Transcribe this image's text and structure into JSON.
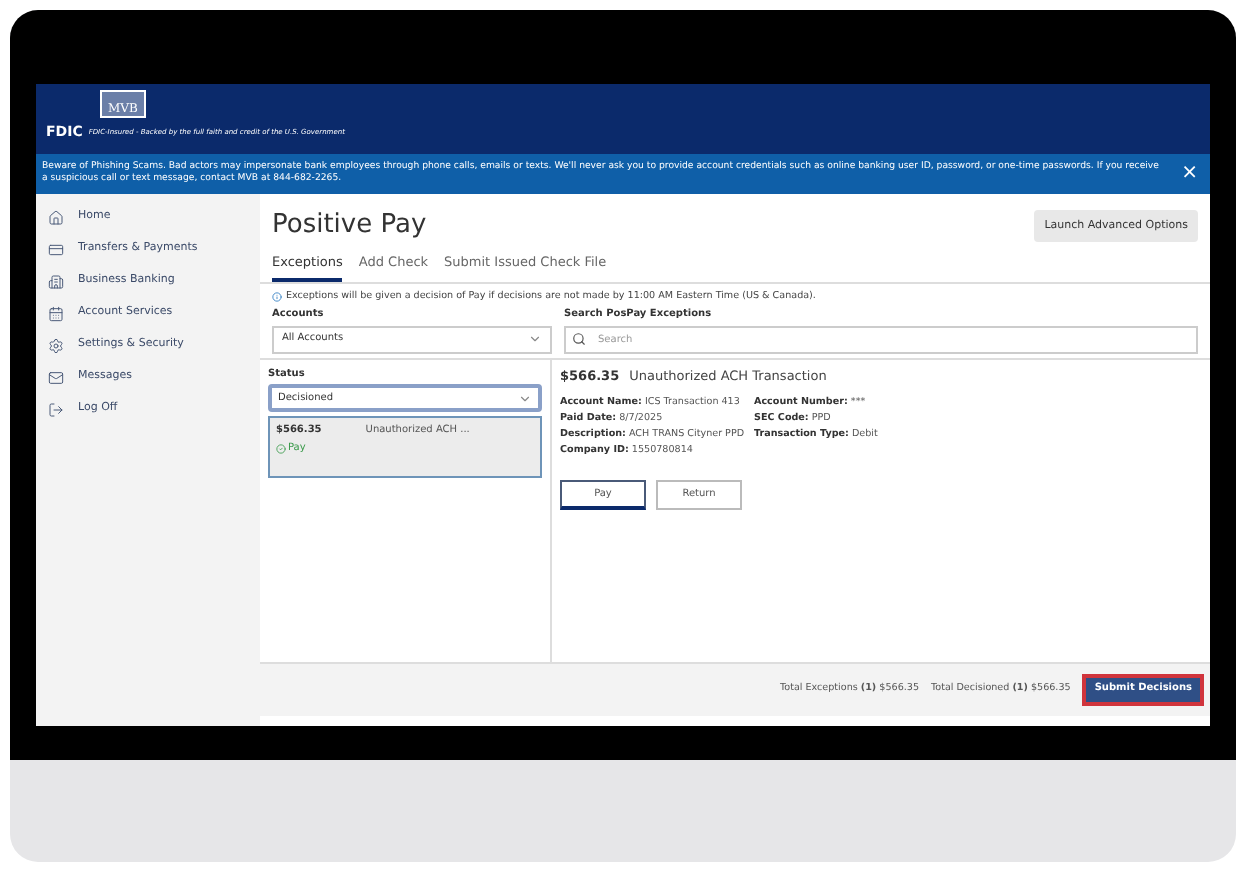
{
  "header": {
    "logo": "MVB",
    "fdic_mark": "FDIC",
    "fdic_text": "FDIC-Insured - Backed by the full faith and credit of the U.S. Government"
  },
  "banner": {
    "text": "Beware of Phishing Scams. Bad actors may impersonate bank employees through phone calls, emails or texts. We'll never ask you to provide account credentials such as online banking user ID, password, or one-time passwords. If you receive a suspicious call or text message, contact MVB at 844-682-2265.",
    "close": "×"
  },
  "sidebar": {
    "items": [
      {
        "label": "Home",
        "kind": "home",
        "selected": false
      },
      {
        "label": "Transfers & Payments",
        "kind": "card",
        "selected": false
      },
      {
        "label": "Business Banking",
        "kind": "building",
        "selected": false
      },
      {
        "label": "Account Services",
        "kind": "calendar",
        "selected": false
      },
      {
        "label": "Settings & Security",
        "kind": "gear",
        "selected": false
      },
      {
        "label": "Messages",
        "kind": "mail",
        "selected": false
      },
      {
        "label": "Log Off",
        "kind": "logout",
        "selected": false
      }
    ]
  },
  "page": {
    "title": "Positive Pay",
    "launch_button": "Launch Advanced Options",
    "tabs": [
      {
        "label": "Exceptions",
        "selected": true
      },
      {
        "label": "Add Check",
        "selected": false
      },
      {
        "label": "Submit Issued Check File",
        "selected": false
      }
    ],
    "notice": "Exceptions will be given a decision of Pay if decisions are not made by 11:00 AM Eastern Time (US & Canada).",
    "accounts": {
      "label": "Accounts",
      "value": "All Accounts"
    },
    "search": {
      "label": "Search PosPay Exceptions",
      "placeholder": "Search"
    },
    "status": {
      "label": "Status",
      "value": "Decisioned"
    },
    "exceptions": [
      {
        "amount": "$566.35",
        "description": "Unauthorized ACH ...",
        "decision": "Pay",
        "selected": true
      }
    ],
    "detail": {
      "amount": "$566.35",
      "title": "Unauthorized ACH Transaction",
      "fields_left": [
        {
          "label": "Account Name:",
          "value": "ICS Transaction 413"
        },
        {
          "label": "Paid Date:",
          "value": "8/7/2025"
        },
        {
          "label": "Description:",
          "value": "ACH TRANS Cityner PPD"
        },
        {
          "label": "Company ID:",
          "value": "1550780814"
        }
      ],
      "fields_right": [
        {
          "label": "Account Number:",
          "value": "***"
        },
        {
          "label": "SEC Code:",
          "value": "PPD"
        },
        {
          "label": "Transaction Type:",
          "value": "Debit"
        }
      ],
      "actions": [
        {
          "label": "Pay",
          "selected": true
        },
        {
          "label": "Return",
          "selected": false
        }
      ]
    },
    "footer": {
      "exceptions_label": "Total Exceptions",
      "exceptions_count": "(1)",
      "exceptions_total": "$566.35",
      "decisioned_label": "Total Decisioned",
      "decisioned_count": "(1)",
      "decisioned_total": "$566.35",
      "submit": "Submit Decisions"
    }
  }
}
